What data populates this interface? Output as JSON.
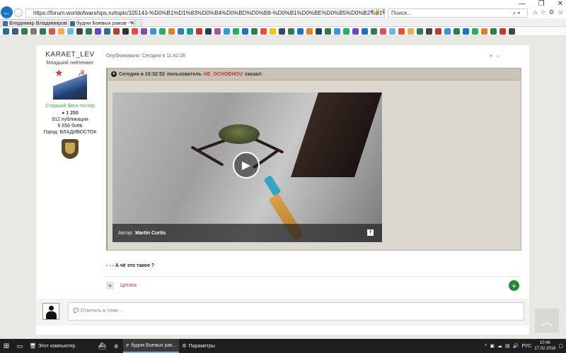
{
  "browser": {
    "url": "https://forum.worldofwarships.ru/topic/105143-%D0%B1%D1%83%D0%B4%D0%BD%D0%B8-%D0%B1%D0%BE%D0%B5%D0%B2%D1%8B%D1%85-%D1%80%D0%B0%D0%BA%D0%BE%D0%B2/?page=28...",
    "search_placeholder": "Поиск...",
    "tabs": [
      {
        "label": "Владимир Владимирович Ги..."
      },
      {
        "label": "будни Боевых раков - Юм..."
      }
    ]
  },
  "post": {
    "author": {
      "name": "KARAET_LEV",
      "rank": "Младший лейтенант",
      "beta": "Старший бета-тестер",
      "reputation": "1 250",
      "posts": "912 публикации",
      "battles": "6 656 боёв",
      "city": "Город: ВЛАДИВОСТОК"
    },
    "published": "Опубликовано: Сегодня в 11:42:28",
    "quote": {
      "time": "Сегодня в 10:32:52",
      "prefix": "пользователь",
      "user": "HE_OCHOBHOU",
      "suffix": "сказал:"
    },
    "video": {
      "author_label": "Автор:",
      "author_name": "Martin Curtis"
    },
    "text": "- - - А чё это такое ?",
    "quote_link": "Цитата"
  },
  "reply": {
    "placeholder": "Ответить в теме..."
  },
  "taskbar": {
    "items": [
      {
        "label": "Этот компьютер"
      },
      {
        "label": "будни Боевых рак..."
      },
      {
        "label": "Параметры"
      }
    ],
    "language": "РУС",
    "time": "10:46",
    "date": "17.02.2018"
  }
}
